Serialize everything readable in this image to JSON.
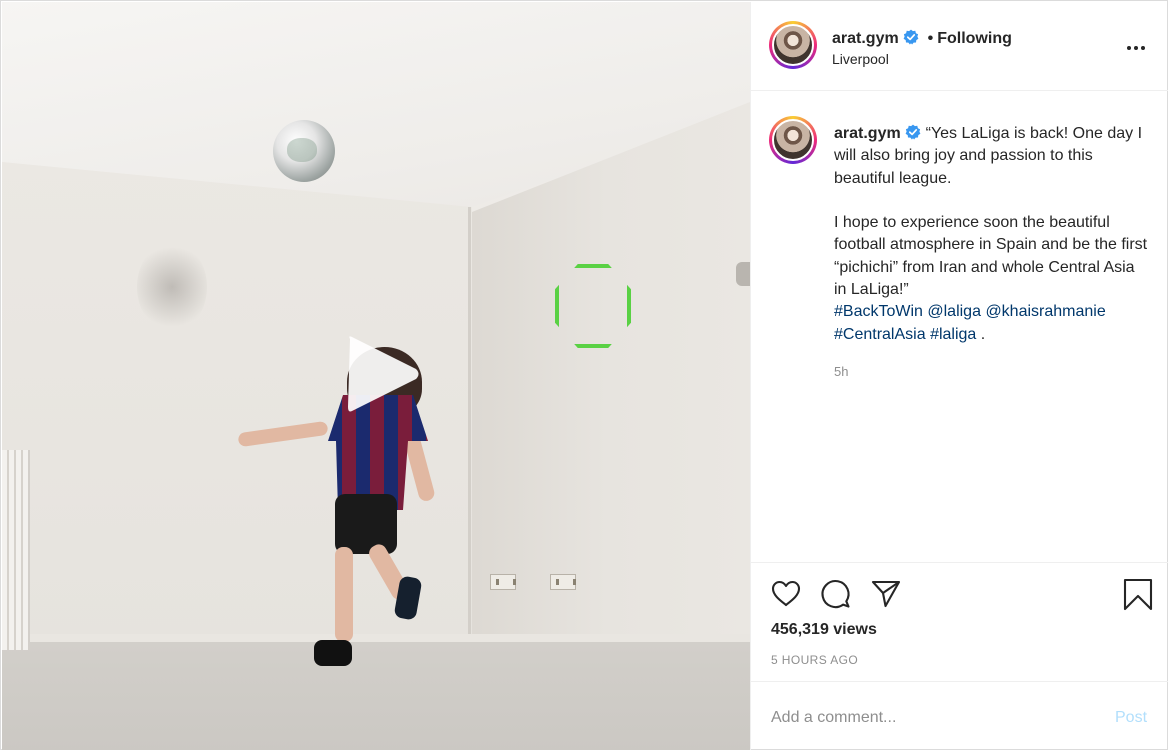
{
  "post": {
    "username": "arat.gym",
    "verified": true,
    "separator": "•",
    "follow_status": "Following",
    "location": "Liverpool"
  },
  "caption": {
    "username": "arat.gym",
    "text_1": "“Yes LaLiga is back! One day I will also bring joy and passion to this beautiful league.\n\nI hope to experience soon the beautiful football atmosphere in Spain and be the first “pichichi” from Iran and whole Central Asia in LaLiga!”\n",
    "hashtag_1": "#BackToWin",
    "mention_1": "@laliga",
    "mention_2": "@khaisrahmanie",
    "hashtag_2": "#CentralAsia",
    "hashtag_3": "#laliga",
    "end": " .",
    "time_short": "5h"
  },
  "stats": {
    "views": "456,319 views",
    "time_ago": "5 HOURS AGO"
  },
  "add_comment": {
    "placeholder": "Add a comment...",
    "post_label": "Post"
  },
  "colors": {
    "verified_blue": "#3897f0",
    "link": "#00376b",
    "post_disabled": "#b2dffc",
    "hoop_green": "#5ad144"
  },
  "icons": [
    "play-icon",
    "more-options-icon",
    "verified-badge-icon",
    "heart-icon",
    "comment-icon",
    "share-icon",
    "bookmark-icon"
  ]
}
